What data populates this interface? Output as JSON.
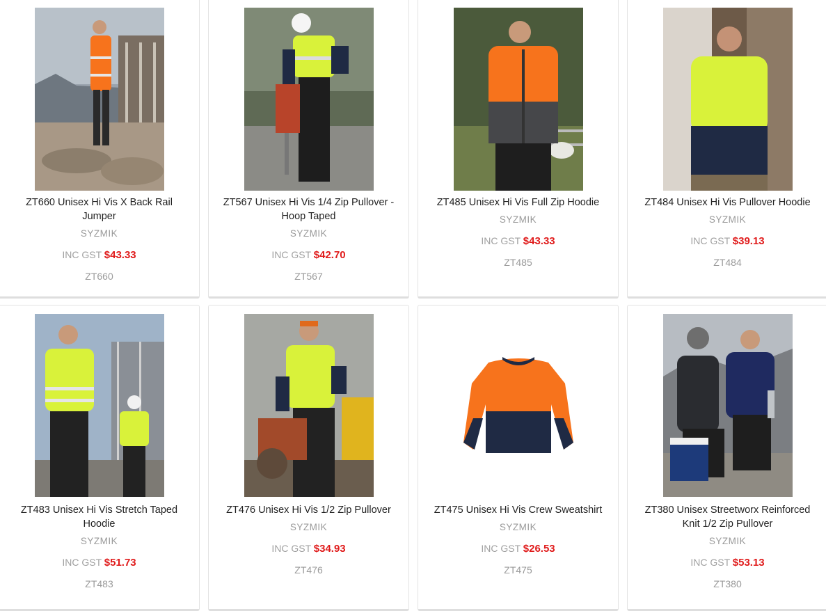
{
  "products": [
    {
      "title": "ZT660 Unisex Hi Vis X Back Rail Jumper",
      "brand": "SYZMIK",
      "gst_label": "INC GST",
      "price": "$43.33",
      "code": "ZT660",
      "image": "man-orange-hivis-jumper-construction-site"
    },
    {
      "title": "ZT567 Unisex Hi Vis 1/4 Zip Pullover - Hoop Taped",
      "brand": "SYZMIK",
      "gst_label": "INC GST",
      "price": "$42.70",
      "code": "ZT567",
      "image": "worker-yellow-pullover-jackhammer"
    },
    {
      "title": "ZT485 Unisex Hi Vis Full Zip Hoodie",
      "brand": "SYZMIK",
      "gst_label": "INC GST",
      "price": "$43.33",
      "code": "ZT485",
      "image": "man-orange-full-zip-hoodie-farm"
    },
    {
      "title": "ZT484 Unisex Hi Vis Pullover Hoodie",
      "brand": "SYZMIK",
      "gst_label": "INC GST",
      "price": "$39.13",
      "code": "ZT484",
      "image": "man-yellow-pullover-hoodie"
    },
    {
      "title": "ZT483 Unisex Hi Vis Stretch Taped Hoodie",
      "brand": "SYZMIK",
      "gst_label": "INC GST",
      "price": "$51.73",
      "code": "ZT483",
      "image": "workers-yellow-taped-hoodie-scaffold"
    },
    {
      "title": "ZT476 Unisex Hi Vis 1/2 Zip Pullover",
      "brand": "SYZMIK",
      "gst_label": "INC GST",
      "price": "$34.93",
      "code": "ZT476",
      "image": "worker-yellow-half-zip-saw"
    },
    {
      "title": "ZT475 Unisex Hi Vis Crew Sweatshirt",
      "brand": "SYZMIK",
      "gst_label": "INC GST",
      "price": "$26.53",
      "code": "ZT475",
      "image": "orange-navy-crew-sweatshirt"
    },
    {
      "title": "ZT380 Unisex Streetworx Reinforced Knit 1/2 Zip Pullover",
      "brand": "SYZMIK",
      "gst_label": "INC GST",
      "price": "$53.13",
      "code": "ZT380",
      "image": "two-men-dark-knit-pullovers-cooler"
    }
  ],
  "colors": {
    "price": "#e01b1b",
    "muted": "#9a9a9a",
    "title": "#222222",
    "border": "#e3e3e3",
    "hivis_orange": "#f7731c",
    "hivis_yellow": "#d9f23a",
    "navy": "#1f2a44"
  }
}
